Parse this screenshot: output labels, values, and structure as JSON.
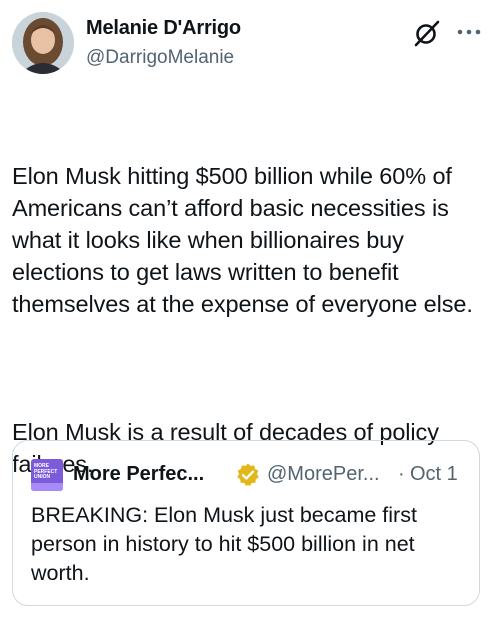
{
  "author": {
    "name": "Melanie D'Arrigo",
    "handle": "@DarrigoMelanie"
  },
  "tweet": {
    "paragraphs": [
      "Elon Musk hitting $500 billion while 60% of Americans can’t afford basic necessities is what it looks like when billionaires buy elections to get laws written to benefit themselves at the expense of everyone else.",
      "Elon Musk is a result of decades of policy failures."
    ]
  },
  "quote": {
    "avatar_text": "MORE PERFECT UNION",
    "name": "More Perfec...",
    "handle": "@MorePer...",
    "separator": "·",
    "time": "Oct 1",
    "text": "BREAKING: Elon Musk just became first person in history to hit $500 billion in net worth."
  },
  "icons": {
    "grok": "grok-slash-icon",
    "more": "more-horizontal-icon",
    "verified": "gold-verified-badge-icon"
  },
  "colors": {
    "text": "#0f1419",
    "secondary": "#536471",
    "border": "#cfd9de",
    "verified_gold": "#e2b719",
    "org_avatar": "#7b5bd9"
  }
}
